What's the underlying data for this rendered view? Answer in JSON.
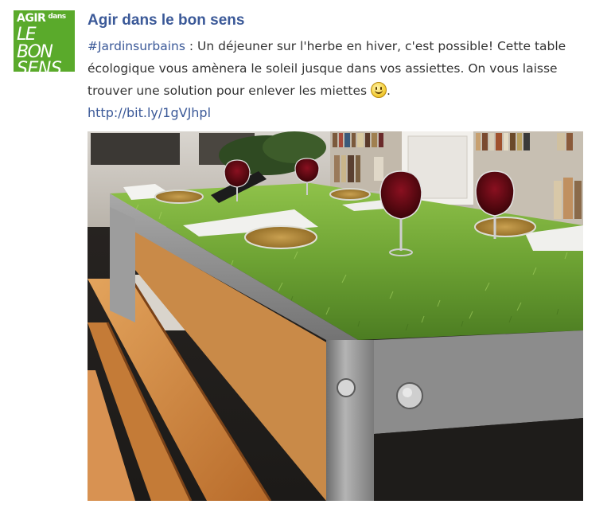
{
  "avatar": {
    "line1": "AGIR",
    "line1_small": "dans",
    "line2": "LE BON",
    "line3": "SENS",
    "bg_color": "#5aaa2b"
  },
  "post": {
    "page_name": "Agir dans le bon sens",
    "hashtag": "#Jardinsurbains",
    "text": " : Un déjeuner sur l'herbe en hiver, c'est possible! Cette table écologique vous amènera le soleil jusque dans vos assiettes. On vous laisse trouver une solution pour enlever les miettes ",
    "text_end": ".",
    "emoji": "smiley-icon",
    "link": "http://bit.ly/1gVJhpl",
    "link_color": "#3b5998"
  },
  "image": {
    "subject": "photo",
    "alt": ""
  }
}
